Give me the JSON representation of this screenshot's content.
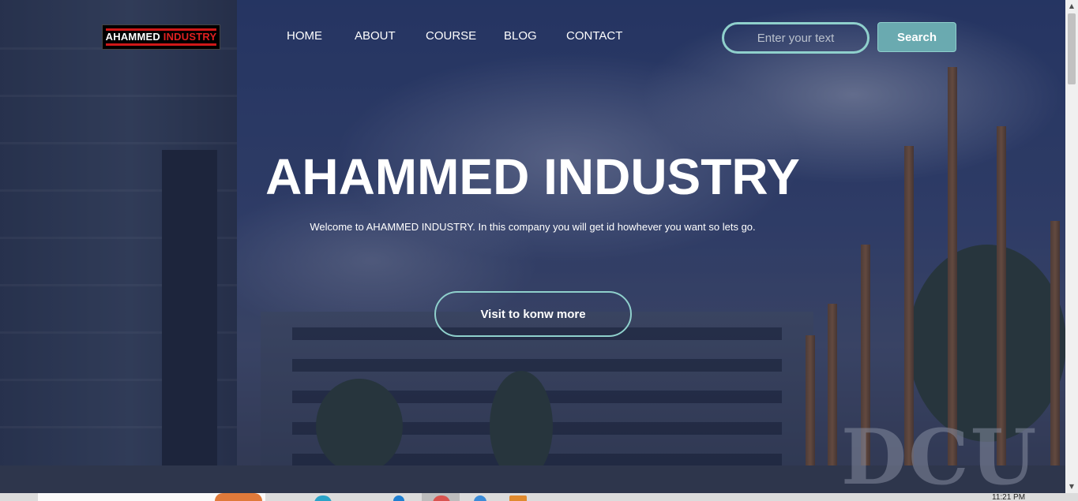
{
  "logo": {
    "text_main": "AHAMMED",
    "text_accent": "INDUSTRY"
  },
  "nav": {
    "items": [
      {
        "label": "HOME"
      },
      {
        "label": "ABOUT"
      },
      {
        "label": "COURSE"
      },
      {
        "label": "BLOG"
      },
      {
        "label": "CONTACT"
      }
    ]
  },
  "search": {
    "placeholder": "Enter your text",
    "button_label": "Search"
  },
  "hero": {
    "title": "AHAMMED INDUSTRY",
    "subtitle": "Welcome to AHAMMED INDUSTRY. In this company you will get id howhever you want so lets go.",
    "cta_label": "Visit to konw more",
    "background_sign": "DCU"
  },
  "taskbar": {
    "clock": "11:21 PM"
  },
  "colors": {
    "accent_border": "#8fd0cc",
    "search_button": "#6aaab0",
    "logo_red": "#d01818"
  }
}
